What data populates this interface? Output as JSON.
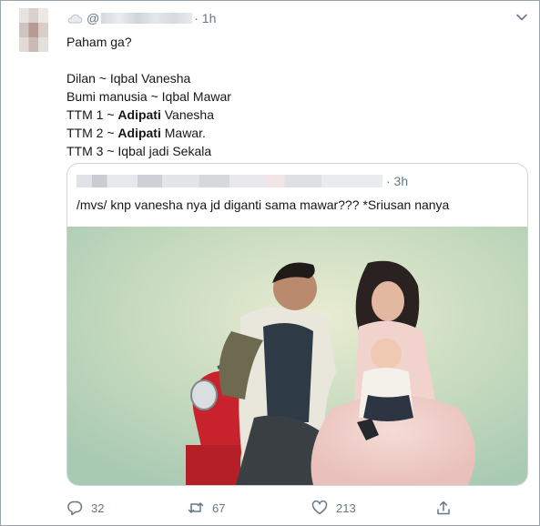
{
  "tweet": {
    "handle_prefix": "@",
    "time": "1h",
    "lines": [
      "Paham ga?",
      "",
      "Dilan ~ Iqbal Vanesha",
      "Bumi manusia ~ Iqbal Mawar"
    ],
    "ttm1": {
      "prefix": "TTM 1 ~ ",
      "bold": "Adipati",
      "suffix": " Vanesha"
    },
    "ttm2": {
      "prefix": "TTM 2 ~ ",
      "bold": "Adipati",
      "suffix": " Mawar."
    },
    "ttm3": "TTM 3 ~ Iqbal jadi Sekala"
  },
  "quote": {
    "time": "· 3h",
    "text": "/mvs/ knp vanesha nya jd diganti sama mawar??? *Sriusan nanya"
  },
  "actions": {
    "replies": "32",
    "retweets": "67",
    "likes": "213"
  },
  "icons": [
    "cloud-icon",
    "chevron-down-icon",
    "reply-icon",
    "retweet-icon",
    "heart-icon",
    "share-icon"
  ],
  "colors": {
    "muted": "#657786",
    "text": "#14171a",
    "border": "#ccd6dd"
  }
}
